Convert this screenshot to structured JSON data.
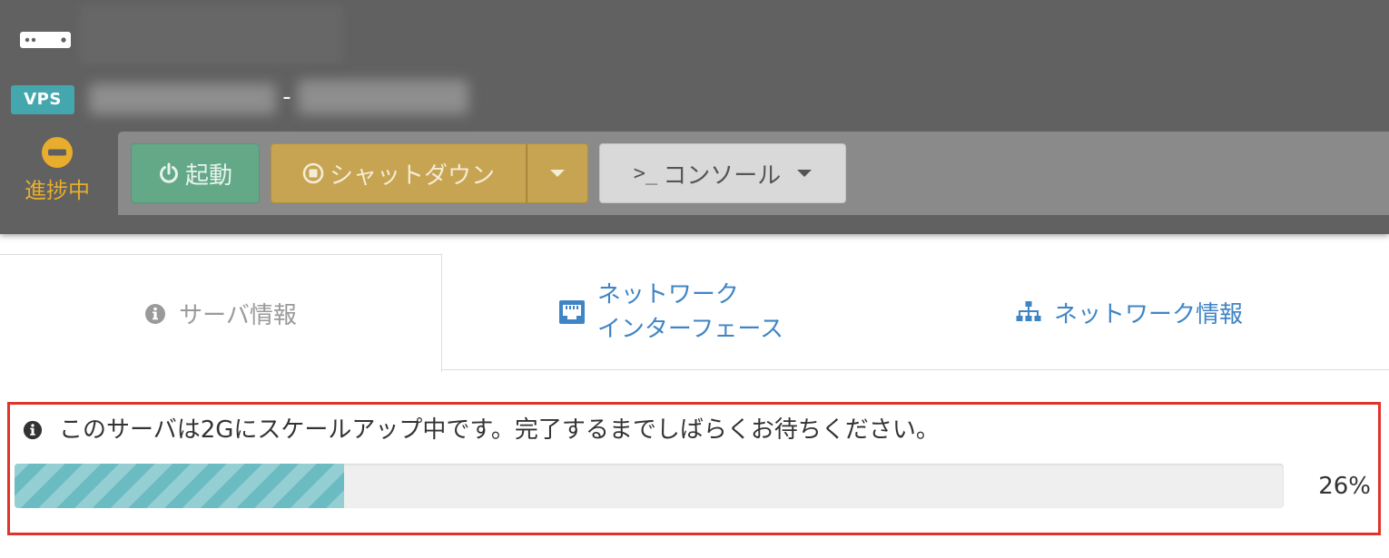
{
  "header": {
    "badge": "VPS",
    "name_separator": "-",
    "status_label": "進捗中"
  },
  "toolbar": {
    "start_label": "起動",
    "shutdown_label": "シャットダウン",
    "console_label": "コンソール",
    "console_prefix": ">_"
  },
  "tabs": [
    {
      "label": "サーバ情報",
      "active": true,
      "icon": "info-circle-icon"
    },
    {
      "label_line1": "ネットワーク",
      "label_line2": "インターフェース",
      "active": false,
      "icon": "ethernet-port-icon"
    },
    {
      "label": "ネットワーク情報",
      "active": false,
      "icon": "sitemap-icon"
    }
  ],
  "notice": {
    "message": "このサーバは2Gにスケールアップ中です。完了するまでしばらくお待ちください。",
    "progress_percent": 26,
    "progress_label": "26%"
  },
  "colors": {
    "header_bg": "#616161",
    "badge": "#45a7ae",
    "status": "#e8ad2c",
    "start_button": "#63a887",
    "shutdown_button": "#c6a451",
    "console_button": "#d9d9d9",
    "tab_link": "#3f85c6",
    "progress_fill": "#6bbcc2",
    "highlight_border": "#e0332a"
  }
}
